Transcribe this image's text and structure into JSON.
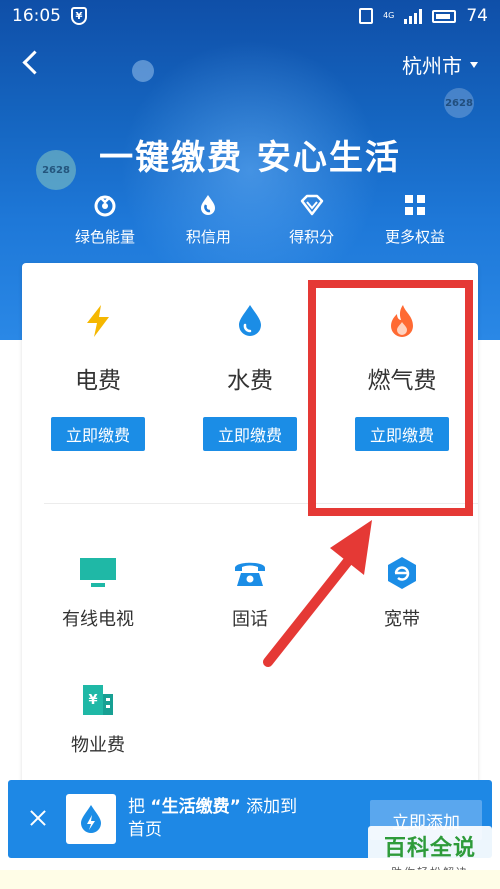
{
  "status_bar": {
    "time": "16:05",
    "shield_glyph": "¥",
    "network": "4G",
    "battery": "74"
  },
  "nav": {
    "city": "杭州市"
  },
  "hero": {
    "slogan": "一键缴费  安心生活",
    "bubble_text": "2628",
    "benefits": [
      {
        "label": "绿色能量",
        "icon": "leaf-medal-icon"
      },
      {
        "label": "积信用",
        "icon": "credit-drop-icon"
      },
      {
        "label": "得积分",
        "icon": "diamond-icon"
      },
      {
        "label": "更多权益",
        "icon": "grid-icon"
      }
    ]
  },
  "bills": [
    {
      "name": "电费",
      "button": "立即缴费",
      "icon": "lightning-icon",
      "color": "#f5b700"
    },
    {
      "name": "水费",
      "button": "立即缴费",
      "icon": "water-drop-icon",
      "color": "#1b8de6"
    },
    {
      "name": "燃气费",
      "button": "立即缴费",
      "icon": "flame-icon",
      "color": "#ff6a33"
    }
  ],
  "services": [
    {
      "name": "有线电视",
      "icon": "tv-icon",
      "color": "#1fb8a6"
    },
    {
      "name": "固话",
      "icon": "telephone-icon",
      "color": "#1b8de6"
    },
    {
      "name": "宽带",
      "icon": "broadband-icon",
      "color": "#1b8de6"
    },
    {
      "name": "物业费",
      "icon": "building-icon",
      "color": "#1fb8a6"
    }
  ],
  "banner": {
    "prefix": "把",
    "app_name": "“生活缴费”",
    "suffix": "添加到",
    "line2": "首页",
    "button": "立即添加"
  },
  "watermark": {
    "title": "百科全说",
    "subtitle": "助你轻松解决"
  },
  "colors": {
    "primary": "#1b8de6",
    "highlight": "#e53935",
    "watermark_green": "#2e9b3a"
  }
}
